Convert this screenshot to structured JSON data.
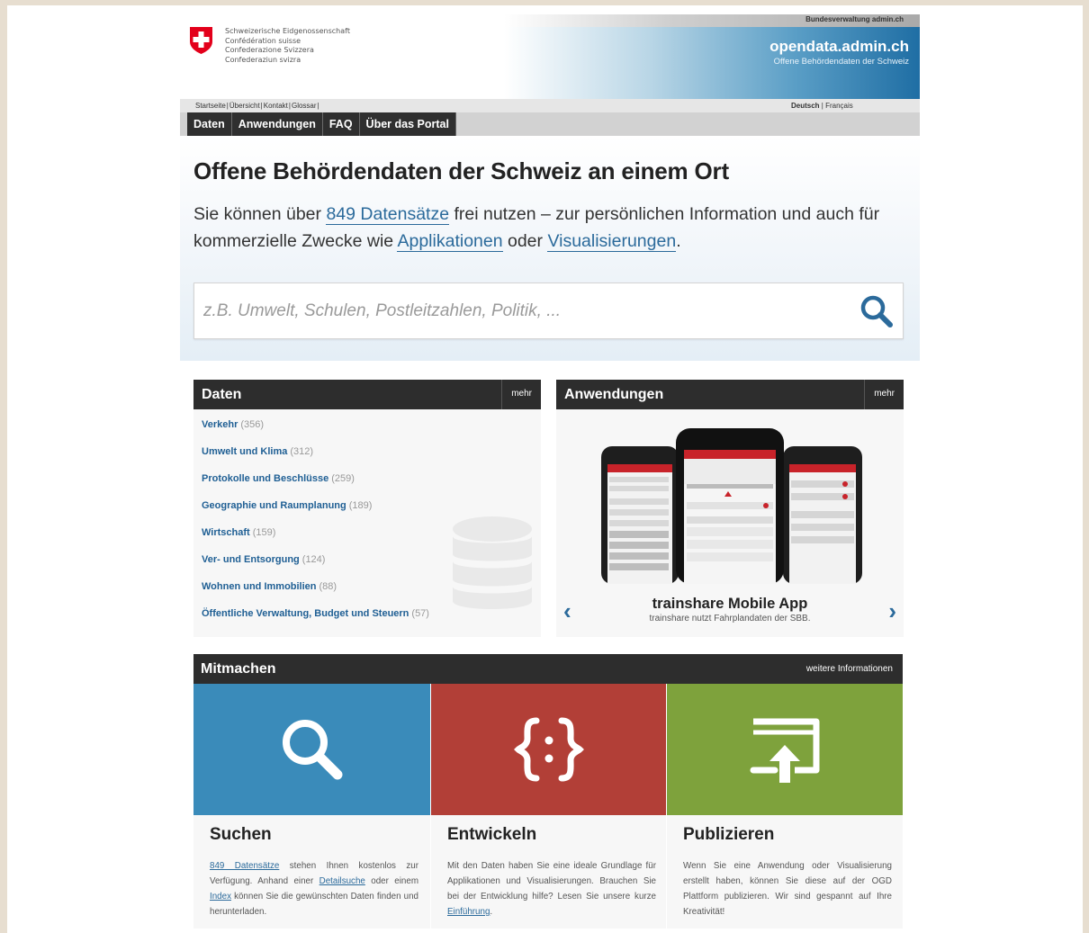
{
  "header": {
    "confederation_lines": [
      "Schweizerische Eidgenossenschaft",
      "Confédération suisse",
      "Confederazione Svizzera",
      "Confederaziun svizra"
    ],
    "admin_link": "Bundesverwaltung admin.ch",
    "site_name": "opendata.admin.ch",
    "site_subtitle": "Offene Behördendaten der Schweiz"
  },
  "meta_nav": {
    "links": [
      "Startseite",
      "Übersicht",
      "Kontakt",
      "Glossar"
    ],
    "lang_active": "Deutsch",
    "lang_other": "Français"
  },
  "main_nav": [
    "Daten",
    "Anwendungen",
    "FAQ",
    "Über das Portal"
  ],
  "hero": {
    "title": "Offene Behördendaten der Schweiz an einem Ort",
    "intro_1": "Sie können über ",
    "datasets_link": "849 Datensätze",
    "intro_2": " frei nutzen – zur persönlichen Information und auch für kommerzielle Zwecke wie ",
    "apps_link": "Applikationen",
    "intro_3": " oder ",
    "vis_link": "Visualisierungen",
    "intro_4": ".",
    "search_placeholder": "z.B. Umwelt, Schulen, Postleitzahlen, Politik, ..."
  },
  "daten_panel": {
    "title": "Daten",
    "more": "mehr",
    "items": [
      {
        "label": "Verkehr",
        "count": "(356)"
      },
      {
        "label": "Umwelt und Klima",
        "count": "(312)"
      },
      {
        "label": "Protokolle und Beschlüsse",
        "count": "(259)"
      },
      {
        "label": "Geographie und Raumplanung",
        "count": "(189)"
      },
      {
        "label": "Wirtschaft",
        "count": "(159)"
      },
      {
        "label": "Ver- und Entsorgung",
        "count": "(124)"
      },
      {
        "label": "Wohnen und Immobilien",
        "count": "(88)"
      },
      {
        "label": "Öffentliche Verwaltung, Budget und Steuern",
        "count": "(57)"
      }
    ]
  },
  "apps_panel": {
    "title": "Anwendungen",
    "more": "mehr",
    "app_name": "trainshare Mobile App",
    "app_desc": "trainshare nutzt Fahrplandaten der SBB.",
    "prev_arrow": "‹",
    "next_arrow": "›"
  },
  "mitmachen": {
    "title": "Mitmachen",
    "more": "weitere Informationen",
    "colors": {
      "suchen": "#3a8bba",
      "entwickeln": "#b23f37",
      "publizieren": "#7ea23c"
    },
    "suchen": {
      "title": "Suchen",
      "link1": "849 Datensätze",
      "t1": " stehen Ihnen kostenlos zur Verfügung. Anhand einer ",
      "link2": "Detailsuche",
      "t2": " oder einem ",
      "link3": "Index",
      "t3": " können Sie die gewünschten Daten finden und herunterladen."
    },
    "entwickeln": {
      "title": "Entwickeln",
      "t1": "Mit den Daten haben Sie eine ideale Grundlage für Applikationen und Visualisierungen. Brauchen Sie bei der Entwicklung hilfe? Lesen Sie unsere kurze ",
      "link1": "Einführung",
      "t2": "."
    },
    "publizieren": {
      "title": "Publizieren",
      "t1": "Wenn Sie eine Anwendung oder Visualisierung erstellt haben, können Sie diese auf der OGD Plattform publizieren. Wir sind gespannt auf Ihre Kreativität!"
    }
  }
}
